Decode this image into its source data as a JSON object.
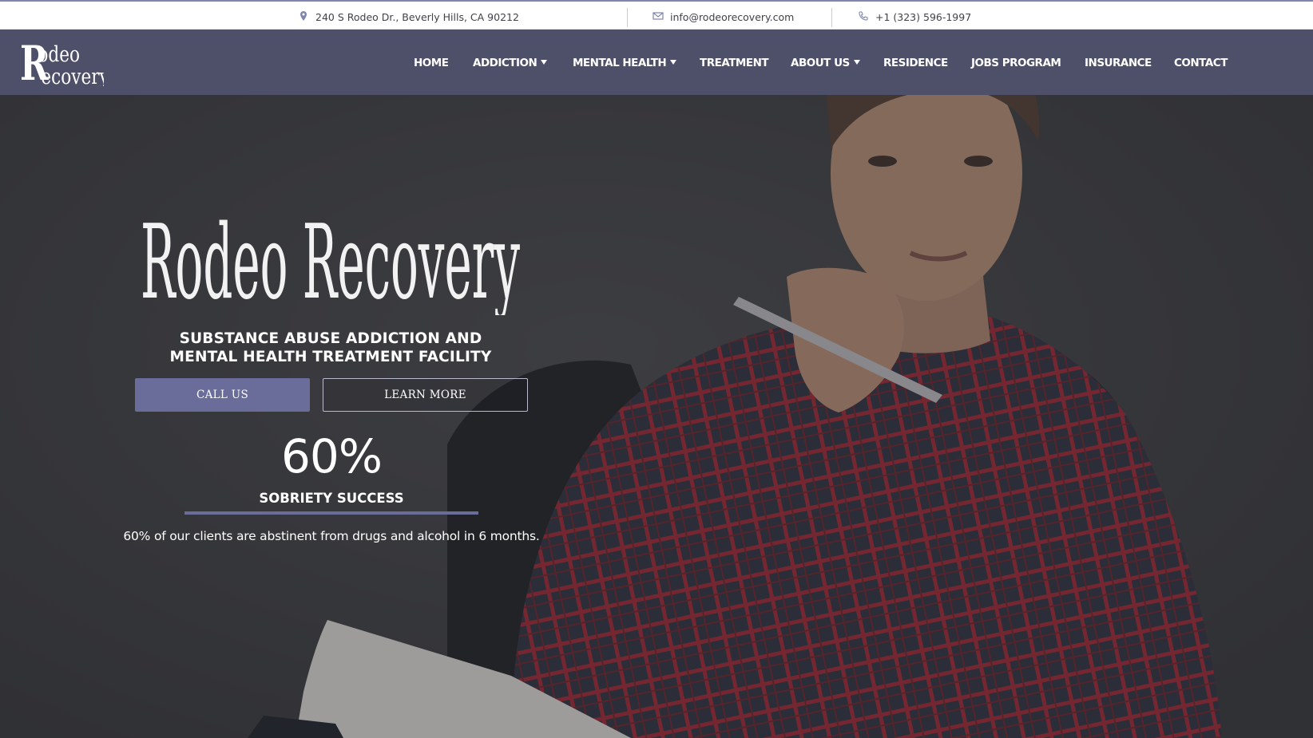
{
  "topbar": {
    "address": "240 S Rodeo Dr., Beverly Hills, CA 90212",
    "email": "info@rodeorecovery.com",
    "phone": "+1 (323) 596-1997"
  },
  "brand": {
    "logo_text_line1": "odeo",
    "logo_text_line2": "ecovery",
    "hero_logo_text": "Rodeo Recovery"
  },
  "nav": {
    "items": [
      {
        "label": "HOME",
        "dropdown": false
      },
      {
        "label": "ADDICTION",
        "dropdown": true
      },
      {
        "label": "MENTAL HEALTH",
        "dropdown": true
      },
      {
        "label": "TREATMENT",
        "dropdown": false
      },
      {
        "label": "ABOUT US",
        "dropdown": true
      },
      {
        "label": "RESIDENCE",
        "dropdown": false
      },
      {
        "label": "JOBS PROGRAM",
        "dropdown": false
      },
      {
        "label": "INSURANCE",
        "dropdown": false
      },
      {
        "label": "CONTACT",
        "dropdown": false
      }
    ]
  },
  "hero": {
    "subtitle_line1": "SUBSTANCE ABUSE ADDICTION AND",
    "subtitle_line2": "MENTAL HEALTH TREATMENT FACILITY",
    "call_button": "CALL US",
    "learn_button": "LEARN MORE",
    "stat_value": "60%",
    "stat_label": "SOBRIETY SUCCESS",
    "stat_description": "60% of our clients are abstinent from drugs and alcohol in 6 months."
  },
  "colors": {
    "accent": "#6a6d9a",
    "nav_background": "#50526e",
    "hero_background": "#3b3c40",
    "shirt_red": "#b0232e",
    "topbar_text": "#41424a"
  }
}
